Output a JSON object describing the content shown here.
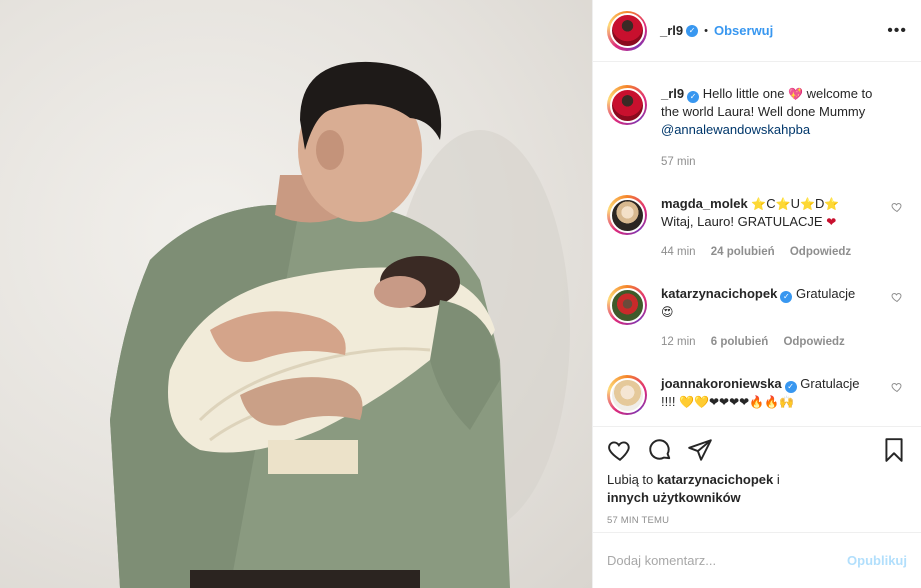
{
  "post": {
    "author": "_rl9",
    "follow_label": "Obserwuj",
    "more_label": "•••",
    "caption": {
      "author": "_rl9",
      "text_before": "Hello little one",
      "emoji": "💖",
      "text_after": "welcome to the world Laura! Well done Mummy",
      "mention": "@annalewandowskahpba",
      "time": "57 min"
    }
  },
  "comments": [
    {
      "user": "magda_molek",
      "verified": false,
      "text_emoji_1": "⭐",
      "text_1": "C",
      "text_emoji_2": "⭐",
      "text_2": "U",
      "text_emoji_3": "⭐",
      "text_3": "D",
      "text_emoji_4": "⭐",
      "text_4": "Witaj, Lauro! GRATULACJE",
      "text_emoji_5": "❤",
      "time": "44 min",
      "likes": "24 polubień",
      "reply": "Odpowiedz"
    },
    {
      "user": "katarzynacichopek",
      "verified": true,
      "text": "Gratulacje",
      "emoji": "😍",
      "time": "12 min",
      "likes": "6 polubień",
      "reply": "Odpowiedz"
    },
    {
      "user": "joannakoroniewska",
      "verified": true,
      "text": "Gratulacje",
      "text_2": "!!!!",
      "emoji": "💛💛❤❤❤❤🔥🔥🙌"
    }
  ],
  "liked_by": {
    "prefix": "Lubią to",
    "user": "katarzynacichopek",
    "connector": "i",
    "others": "innych użytkowników"
  },
  "time_ago": "57 MIN TEMU",
  "add_comment": {
    "placeholder": "Dodaj komentarz...",
    "publish_label": "Opublikuj"
  },
  "colors": {
    "accent": "#3897f0",
    "publish_disabled": "#b2dffc",
    "sweater": "#8a9a80",
    "like_heart": "#c8102e"
  },
  "icons": {
    "like": "heart-icon",
    "comment": "comment-bubble-icon",
    "share": "paper-plane-icon",
    "save": "bookmark-icon",
    "verified": "verified-badge-icon"
  }
}
